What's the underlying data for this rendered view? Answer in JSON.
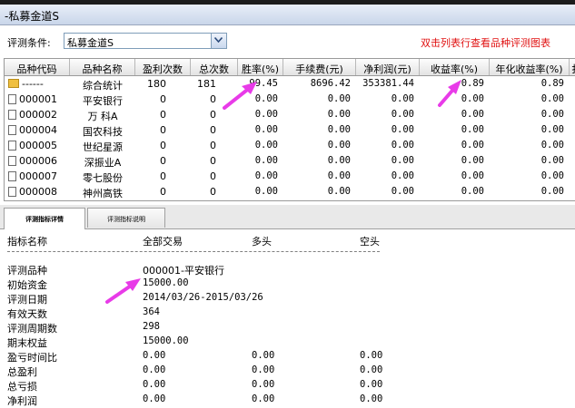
{
  "window": {
    "title": "-私募金道S"
  },
  "condition": {
    "label": "评测条件:",
    "selected": "私募金道S"
  },
  "hint": "双击列表行查看品种评测图表",
  "table": {
    "headers": [
      "品种代码",
      "品种名称",
      "盈利次数",
      "总次数",
      "胜率(%)",
      "手续费(元)",
      "净利润(元)",
      "收益率(%)",
      "年化收益率(%)",
      "扌"
    ],
    "rows": [
      {
        "code": "------",
        "name": "综合统计",
        "wins": "180",
        "total": "181",
        "winrate": "99.45",
        "fee": "8696.42",
        "profit": "353381.44",
        "ret": "0.89",
        "annual": "0.89"
      },
      {
        "code": "000001",
        "name": "平安银行",
        "wins": "0",
        "total": "0",
        "winrate": "0.00",
        "fee": "0.00",
        "profit": "0.00",
        "ret": "0.00",
        "annual": "0.00"
      },
      {
        "code": "000002",
        "name": "万  科A",
        "wins": "0",
        "total": "0",
        "winrate": "0.00",
        "fee": "0.00",
        "profit": "0.00",
        "ret": "0.00",
        "annual": "0.00"
      },
      {
        "code": "000004",
        "name": "国农科技",
        "wins": "0",
        "total": "0",
        "winrate": "0.00",
        "fee": "0.00",
        "profit": "0.00",
        "ret": "0.00",
        "annual": "0.00"
      },
      {
        "code": "000005",
        "name": "世纪星源",
        "wins": "0",
        "total": "0",
        "winrate": "0.00",
        "fee": "0.00",
        "profit": "0.00",
        "ret": "0.00",
        "annual": "0.00"
      },
      {
        "code": "000006",
        "name": "深振业A",
        "wins": "0",
        "total": "0",
        "winrate": "0.00",
        "fee": "0.00",
        "profit": "0.00",
        "ret": "0.00",
        "annual": "0.00"
      },
      {
        "code": "000007",
        "name": "零七股份",
        "wins": "0",
        "total": "0",
        "winrate": "0.00",
        "fee": "0.00",
        "profit": "0.00",
        "ret": "0.00",
        "annual": "0.00"
      },
      {
        "code": "000008",
        "name": "神州高铁",
        "wins": "0",
        "total": "0",
        "winrate": "0.00",
        "fee": "0.00",
        "profit": "0.00",
        "ret": "0.00",
        "annual": "0.00"
      }
    ]
  },
  "tabs": [
    {
      "label": "评测指标详情",
      "active": true
    },
    {
      "label": "评测指标说明",
      "active": false
    }
  ],
  "detail": {
    "headers": [
      "指标名称",
      "全部交易",
      "多头",
      "空头"
    ],
    "rows": [
      {
        "name": "评测品种",
        "all": "000001-平安银行",
        "long": "",
        "short": ""
      },
      {
        "name": "初始资金",
        "all": "15000.00",
        "long": "",
        "short": ""
      },
      {
        "name": "评测日期",
        "all": "2014/03/26-2015/03/26",
        "long": "",
        "short": ""
      },
      {
        "name": "有效天数",
        "all": "364",
        "long": "",
        "short": ""
      },
      {
        "name": "评测周期数",
        "all": "298",
        "long": "",
        "short": ""
      },
      {
        "name": "期末权益",
        "all": "15000.00",
        "long": "",
        "short": ""
      },
      {
        "name": "盈亏时间比",
        "all": "0.00",
        "long": "0.00",
        "short": "0.00"
      },
      {
        "name": "总盈利",
        "all": "0.00",
        "long": "0.00",
        "short": "0.00"
      },
      {
        "name": "总亏损",
        "all": "0.00",
        "long": "0.00",
        "short": "0.00"
      },
      {
        "name": "净利润",
        "all": "0.00",
        "long": "0.00",
        "short": "0.00"
      }
    ]
  },
  "colors": {
    "arrow": "#e83be8",
    "hint": "#e01010"
  }
}
